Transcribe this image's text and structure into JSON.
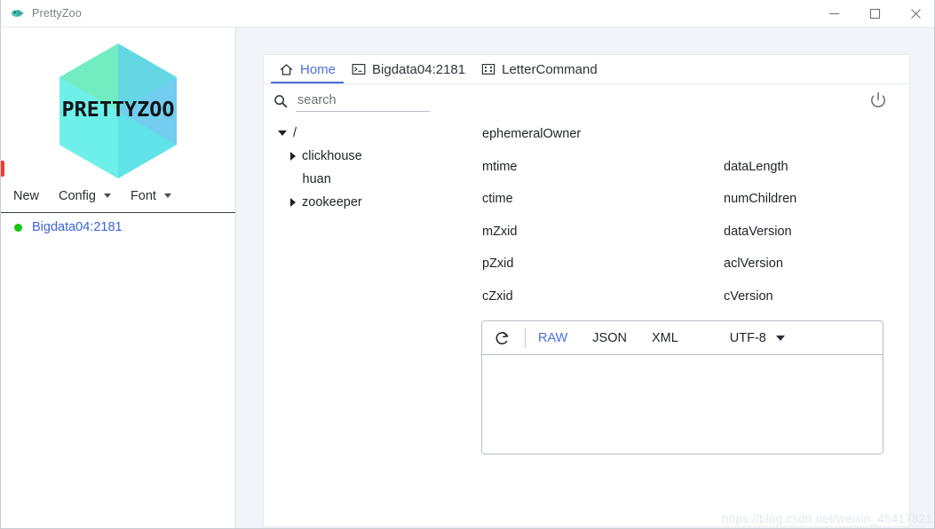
{
  "window": {
    "title": "PrettyZoo",
    "app_icon": "prettyzoo-bird-icon",
    "controls": {
      "minimize": "minimize-icon",
      "maximize": "maximize-icon",
      "close": "close-icon"
    }
  },
  "sidebar": {
    "logo_text": "PRETTYZOO",
    "toolbar": [
      {
        "label": "New",
        "has_caret": false
      },
      {
        "label": "Config",
        "has_caret": true
      },
      {
        "label": "Font",
        "has_caret": true
      }
    ],
    "connections": [
      {
        "label": "Bigdata04:2181",
        "status_color": "#14c814"
      }
    ]
  },
  "tabs": [
    {
      "label": "Home",
      "icon": "home-icon",
      "active": true
    },
    {
      "label": "Bigdata04:2181",
      "icon": "terminal-icon",
      "active": false
    },
    {
      "label": "LetterCommand",
      "icon": "four-dots-icon",
      "active": false
    }
  ],
  "search": {
    "placeholder": "search",
    "value": "",
    "icon": "search-icon"
  },
  "power": {
    "icon": "power-icon"
  },
  "tree": [
    {
      "label": "/",
      "level": 0,
      "state": "expanded"
    },
    {
      "label": "clickhouse",
      "level": 1,
      "state": "collapsed"
    },
    {
      "label": "huan",
      "level": 1,
      "state": "leaf"
    },
    {
      "label": "zookeeper",
      "level": 1,
      "state": "collapsed"
    }
  ],
  "properties": [
    {
      "left": "ephemeralOwner",
      "right": ""
    },
    {
      "left": "mtime",
      "right": "dataLength"
    },
    {
      "left": "ctime",
      "right": "numChildren"
    },
    {
      "left": "mZxid",
      "right": "dataVersion"
    },
    {
      "left": "pZxid",
      "right": "aclVersion"
    },
    {
      "left": "cZxid",
      "right": "cVersion"
    }
  ],
  "data_viewer": {
    "refresh_icon": "refresh-icon",
    "formats": [
      {
        "label": "RAW",
        "active": true
      },
      {
        "label": "JSON",
        "active": false
      },
      {
        "label": "XML",
        "active": false
      }
    ],
    "encoding": "UTF-8",
    "content": ""
  },
  "watermark": "https://blog.csdn.net/weixin_45417821",
  "colors": {
    "accent": "#4a6ee0",
    "link": "#3a63d8",
    "status_online": "#14c814",
    "panel_bg": "#f1f5f9",
    "marker_red": "#ef3b30"
  }
}
